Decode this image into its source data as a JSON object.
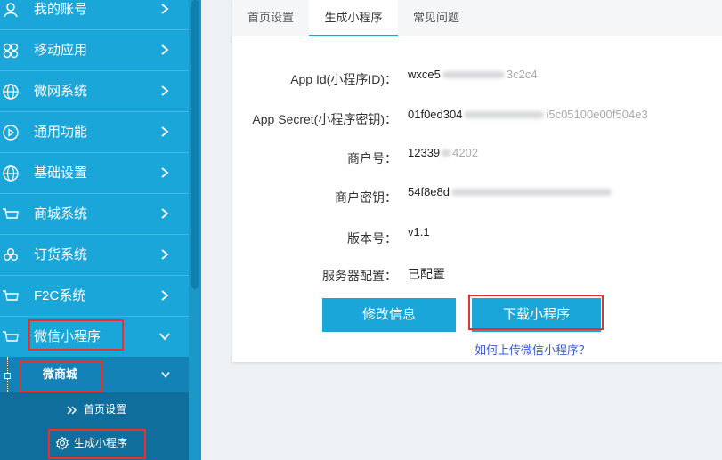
{
  "sidebar": {
    "items": [
      {
        "label": "我的账号",
        "icon": "user-icon"
      },
      {
        "label": "移动应用",
        "icon": "apps-icon"
      },
      {
        "label": "微网系统",
        "icon": "globe-icon"
      },
      {
        "label": "通用功能",
        "icon": "play-circle-icon"
      },
      {
        "label": "基础设置",
        "icon": "globe-icon"
      },
      {
        "label": "商城系统",
        "icon": "cart-icon"
      },
      {
        "label": "订货系统",
        "icon": "clover-icon"
      },
      {
        "label": "F2C系统",
        "icon": "cart-icon"
      },
      {
        "label": "微信小程序",
        "icon": "cart-icon"
      }
    ],
    "sub_item": {
      "label": "微商城"
    },
    "sub_sub_items": [
      {
        "label": "首页设置",
        "icon": "double-chevron-icon"
      },
      {
        "label": "生成小程序",
        "icon": "gear-icon"
      }
    ]
  },
  "tabs": [
    {
      "label": "首页设置"
    },
    {
      "label": "生成小程序"
    },
    {
      "label": "常见问题"
    }
  ],
  "form": {
    "app_id_label": "App Id(小程序ID)：",
    "app_id_value": "wxce5",
    "app_id_tail": "3c2c4",
    "app_secret_label": "App Secret(小程序密钥)：",
    "app_secret_value": "01f0ed304",
    "app_secret_tail": "i5c05100e00f504e3",
    "merchant_no_label": "商户号：",
    "merchant_no_value": "12339",
    "merchant_no_tail": "4202",
    "merchant_key_label": "商户密钥：",
    "merchant_key_value": "54f8e8d",
    "version_label": "版本号：",
    "version_value": "v1.1",
    "server_label": "服务器配置：",
    "server_value": "已配置"
  },
  "buttons": {
    "edit": "修改信息",
    "download": "下载小程序"
  },
  "help_link": "如何上传微信小程序？",
  "colors": {
    "sidebar": "#1aa6d8",
    "accent": "#1aa6d8",
    "highlight": "#e8302e",
    "link": "#3a5ad0"
  }
}
